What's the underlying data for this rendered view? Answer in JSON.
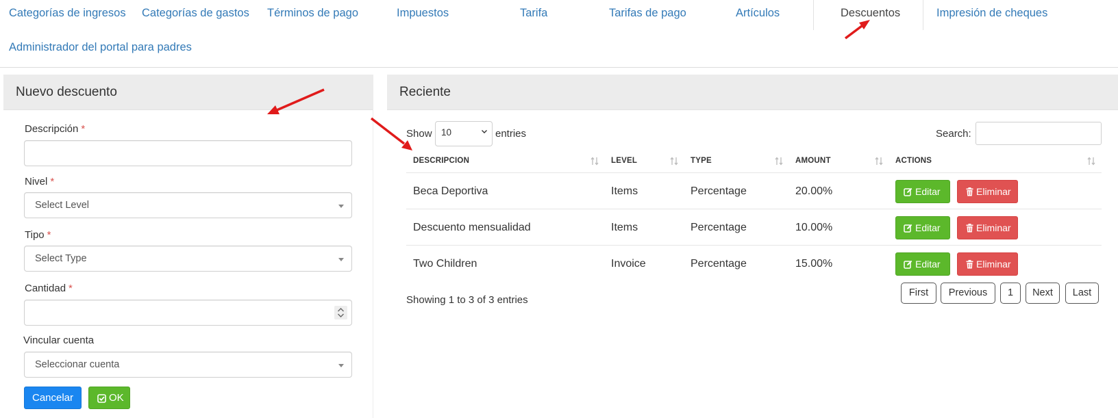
{
  "tabs": [
    {
      "label": "Categorías de ingresos",
      "active": false
    },
    {
      "label": "Categorías de gastos",
      "active": false
    },
    {
      "label": "Términos de pago",
      "active": false
    },
    {
      "label": "Impuestos",
      "active": false
    },
    {
      "label": "Tarifa",
      "active": false
    },
    {
      "label": "Tarifas de pago",
      "active": false
    },
    {
      "label": "Artículos",
      "active": false
    },
    {
      "label": "Descuentos",
      "active": true
    },
    {
      "label": "Impresión de cheques",
      "active": false
    },
    {
      "label": "Administrador del portal para padres",
      "active": false
    }
  ],
  "new_discount": {
    "title": "Nuevo descuento",
    "description_label": "Descripción",
    "description_value": "",
    "level_label": "Nivel",
    "level_value": "Select Level",
    "type_label": "Tipo",
    "type_value": "Select Type",
    "amount_label": "Cantidad",
    "amount_value": "",
    "account_label": "Vincular cuenta",
    "account_value": "Seleccionar cuenta",
    "required_mark": "*",
    "cancel_label": "Cancelar",
    "ok_label": "OK"
  },
  "recent": {
    "title": "Reciente",
    "show_label": "Show",
    "length_value": "10",
    "entries_label": "entries",
    "search_label": "Search:",
    "search_value": "",
    "columns": [
      "DESCRIPCION",
      "LEVEL",
      "TYPE",
      "AMOUNT",
      "ACTIONS"
    ],
    "rows": [
      {
        "descripcion": "Beca Deportiva",
        "level": "Items",
        "type": "Percentage",
        "amount": "20.00%"
      },
      {
        "descripcion": "Descuento mensualidad",
        "level": "Items",
        "type": "Percentage",
        "amount": "10.00%"
      },
      {
        "descripcion": "Two Children",
        "level": "Invoice",
        "type": "Percentage",
        "amount": "15.00%"
      }
    ],
    "edit_label": "Editar",
    "delete_label": "Eliminar",
    "info": "Showing 1 to 3 of 3 entries",
    "pagination": [
      "First",
      "Previous",
      "1",
      "Next",
      "Last"
    ]
  },
  "colors": {
    "link": "#337ab7",
    "primary": "#1a86f0",
    "success": "#5cb82b",
    "danger": "#e05252",
    "annotation_arrow": "#e01b1b"
  },
  "icons": {
    "edit": "edit-icon",
    "delete": "trash-icon",
    "ok": "check-square-icon",
    "sort": "sort-icon",
    "dropdown": "caret-down-icon",
    "spinner": "number-spinner-icon"
  }
}
